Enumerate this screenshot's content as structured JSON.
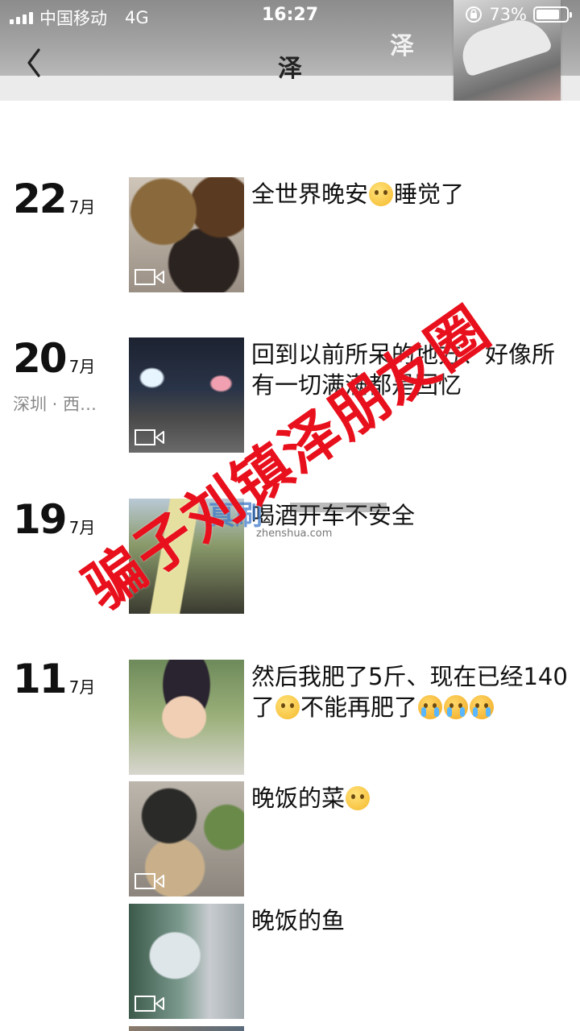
{
  "status_bar": {
    "carrier": "中国移动",
    "network": "4G",
    "time": "16:27",
    "battery": "73%"
  },
  "header": {
    "title": "泽",
    "cover_name": "泽"
  },
  "feed": [
    {
      "day": "22",
      "month": "7月",
      "location": "",
      "posts": [
        {
          "caption": "全世界晚安",
          "caption_after": "睡觉了",
          "emojis": [
            "pleading"
          ],
          "thumb": "food-video",
          "video": true
        }
      ]
    },
    {
      "day": "20",
      "month": "7月",
      "location": "深圳 · 西…",
      "posts": [
        {
          "caption": "回到以前所呆的地方、好像所有一切满满都是回忆",
          "thumb": "night-street-video",
          "video": true
        }
      ]
    },
    {
      "day": "19",
      "month": "7月",
      "location": "",
      "posts": [
        {
          "caption": "喝酒开车不安全",
          "thumb": "drink-photo",
          "video": false
        }
      ]
    },
    {
      "day": "11",
      "month": "7月",
      "location": "",
      "posts": [
        {
          "caption": "然后我肥了5斤、现在已经140了",
          "caption_after": "不能再肥了",
          "thumb": "selfie-photo",
          "video": false
        },
        {
          "caption": "晚饭的菜",
          "thumb": "dinner-video",
          "video": true
        },
        {
          "caption": "晚饭的鱼",
          "thumb": "fish-video",
          "video": true
        }
      ]
    }
  ],
  "watermark": {
    "text": "骗子刘镇泽朋友圈",
    "logo": "真刷",
    "logo_sub": "zhenshua.com",
    "color": "#e8101c"
  },
  "colors": {
    "text": "#111111",
    "secondary_text": "#888888",
    "background": "#ffffff"
  }
}
